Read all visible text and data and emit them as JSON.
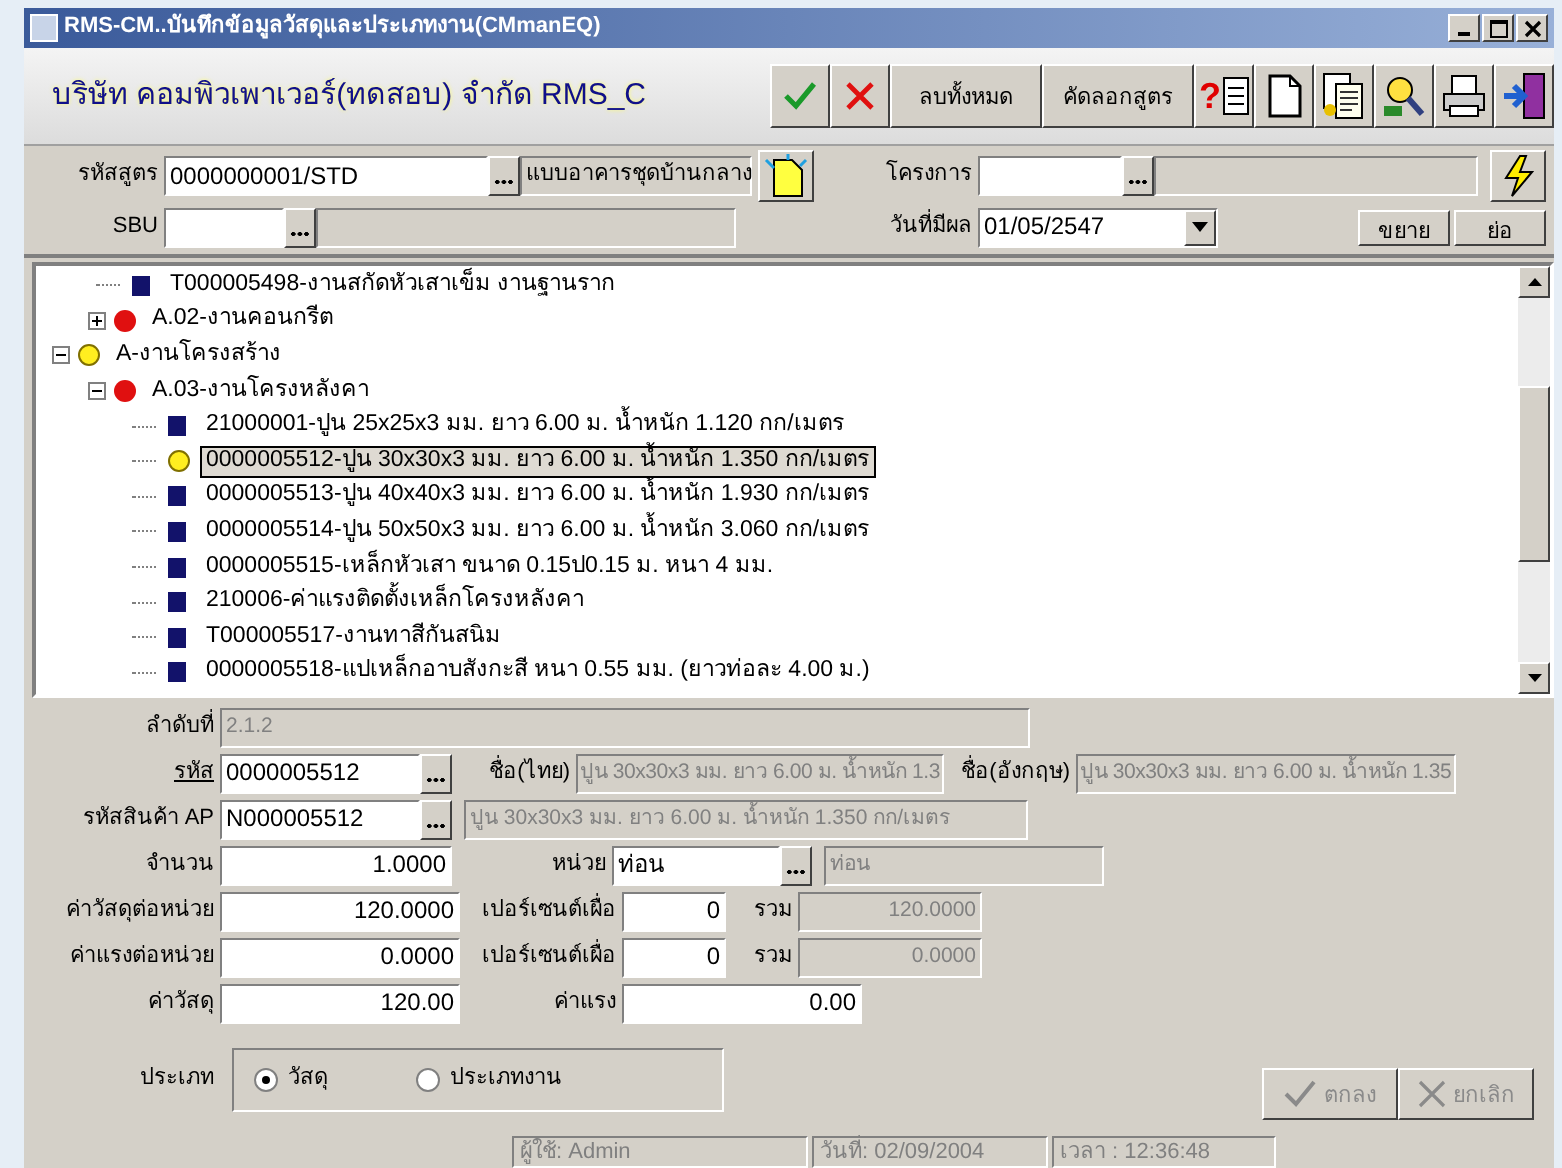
{
  "window": {
    "title": "RMS-CM..บันทึกข้อมูลวัสดุและประเภทงาน(CMmanEQ)"
  },
  "header": {
    "company": "บริษัท คอมพิวเพาเวอร์(ทดสอบ) จำกัด RMS_C",
    "buttons": [
      {
        "kind": "ok"
      },
      {
        "kind": "cancel"
      },
      {
        "kind": "text",
        "label": "ลบทั้งหมด"
      },
      {
        "kind": "text",
        "label": "คัดลอกสูตร"
      },
      {
        "kind": "help",
        "glyph": "?"
      },
      {
        "kind": "new"
      },
      {
        "kind": "report"
      },
      {
        "kind": "search"
      },
      {
        "kind": "print"
      },
      {
        "kind": "exit"
      }
    ]
  },
  "top_form": {
    "formula_label": "รหัสสูตร",
    "formula_code": "0000000001/STD",
    "formula_name": "แบบอาคารชุดบ้านกลาง",
    "sbu_label": "SBU",
    "project_label": "โครงการ",
    "effective_label": "วันที่มีผล",
    "effective_date": "01/05/2547",
    "expand_button": "ขยาย",
    "collapse_button": "ย่อ"
  },
  "tree": [
    {
      "kind": "hidden",
      "children": [
        {
          "kind": "item",
          "label": "T000005498-งานสกัดหัวเสาเข็ม งานฐานราก",
          "selected": false
        },
        {
          "kind": "group",
          "label": "A.02-งานคอนกรีต",
          "expanded": false
        }
      ]
    },
    {
      "kind": "section",
      "label": "A-งานโครงสร้าง",
      "expanded": true,
      "children": [
        {
          "kind": "group",
          "label": "A.03-งานโครงหลังคา",
          "expanded": true,
          "children": [
            {
              "kind": "item",
              "label": "21000001-ปูน 25x25x3 มม. ยาว 6.00 ม. น้ำหนัก 1.120 กก/เมตร",
              "selected": false
            },
            {
              "kind": "item",
              "label": "0000005512-ปูน 30x30x3 มม. ยาว 6.00 ม. น้ำหนัก 1.350 กก/เมตร",
              "selected": true
            },
            {
              "kind": "item",
              "label": "0000005513-ปูน 40x40x3 มม. ยาว 6.00 ม. น้ำหนัก 1.930 กก/เมตร",
              "selected": false
            },
            {
              "kind": "item",
              "label": "0000005514-ปูน 50x50x3 มม. ยาว 6.00 ม. น้ำหนัก 3.060 กก/เมตร",
              "selected": false
            },
            {
              "kind": "item",
              "label": "0000005515-เหล็กหัวเสา ขนาด 0.15ป0.15 ม. หนา 4 มม.",
              "selected": false
            },
            {
              "kind": "item",
              "label": "210006-ค่าแรงติดตั้งเหล็กโครงหลังคา",
              "selected": false
            },
            {
              "kind": "item",
              "label": "T000005517-งานทาสีกันสนิม",
              "selected": false
            },
            {
              "kind": "item",
              "label": "0000005518-แปเหล็กอาบสังกะสี หนา 0.55 มม. (ยาวท่อละ 4.00 ม.)",
              "selected": false
            }
          ]
        }
      ]
    }
  ],
  "detail": {
    "seq_label": "ลำดับที่",
    "seq": "2.1.2",
    "code_label": "รหัส",
    "code": "0000005512",
    "name_th_label": "ชื่อ(ไทย)",
    "name_th": "ปูน 30x30x3 มม. ยาว 6.00 ม. น้ำหนัก 1.3",
    "name_en_label": "ชื่อ(อังกฤษ)",
    "name_en": "ปูน 30x30x3 มม. ยาว 6.00 ม. น้ำหนัก 1.35",
    "ap_label": "รหัสสินค้า AP",
    "ap_code": "N000005512",
    "ap_name": "ปูน 30x30x3 มม. ยาว 6.00 ม. น้ำหนัก 1.350 กก/เมตร",
    "qty_label": "จำนวน",
    "qty": "1.0000",
    "unit_label": "หน่วย",
    "unit": "ท่อน",
    "unit_name": "ท่อน",
    "mat_unit_label": "ค่าวัสดุต่อหน่วย",
    "mat_unit": "120.0000",
    "pct_label_1": "เปอร์เซนต์เผื่อ",
    "pct_1": "0",
    "sum_label_1": "รวม",
    "sum_1": "120.0000",
    "lab_unit_label": "ค่าแรงต่อหน่วย",
    "lab_unit": "0.0000",
    "pct_label_2": "เปอร์เซนต์เผื่อ",
    "pct_2": "0",
    "sum_label_2": "รวม",
    "sum_2": "0.0000",
    "mat_label": "ค่าวัสดุ",
    "mat": "120.00",
    "lab_label": "ค่าแรง",
    "lab": "0.00",
    "type_label": "ประเภท",
    "types": [
      {
        "label": "วัสดุ",
        "selected": true
      },
      {
        "label": "ประเภทงาน",
        "selected": false
      }
    ],
    "ok_button": {
      "label": "ตกลง",
      "disabled": true
    },
    "cancel_button": {
      "label": "ยกเลิก",
      "disabled": true
    }
  },
  "status_bar": [
    "ผู้ใช้: Admin",
    "วันที่: 02/09/2004",
    "เวลา : 12:36:48"
  ]
}
